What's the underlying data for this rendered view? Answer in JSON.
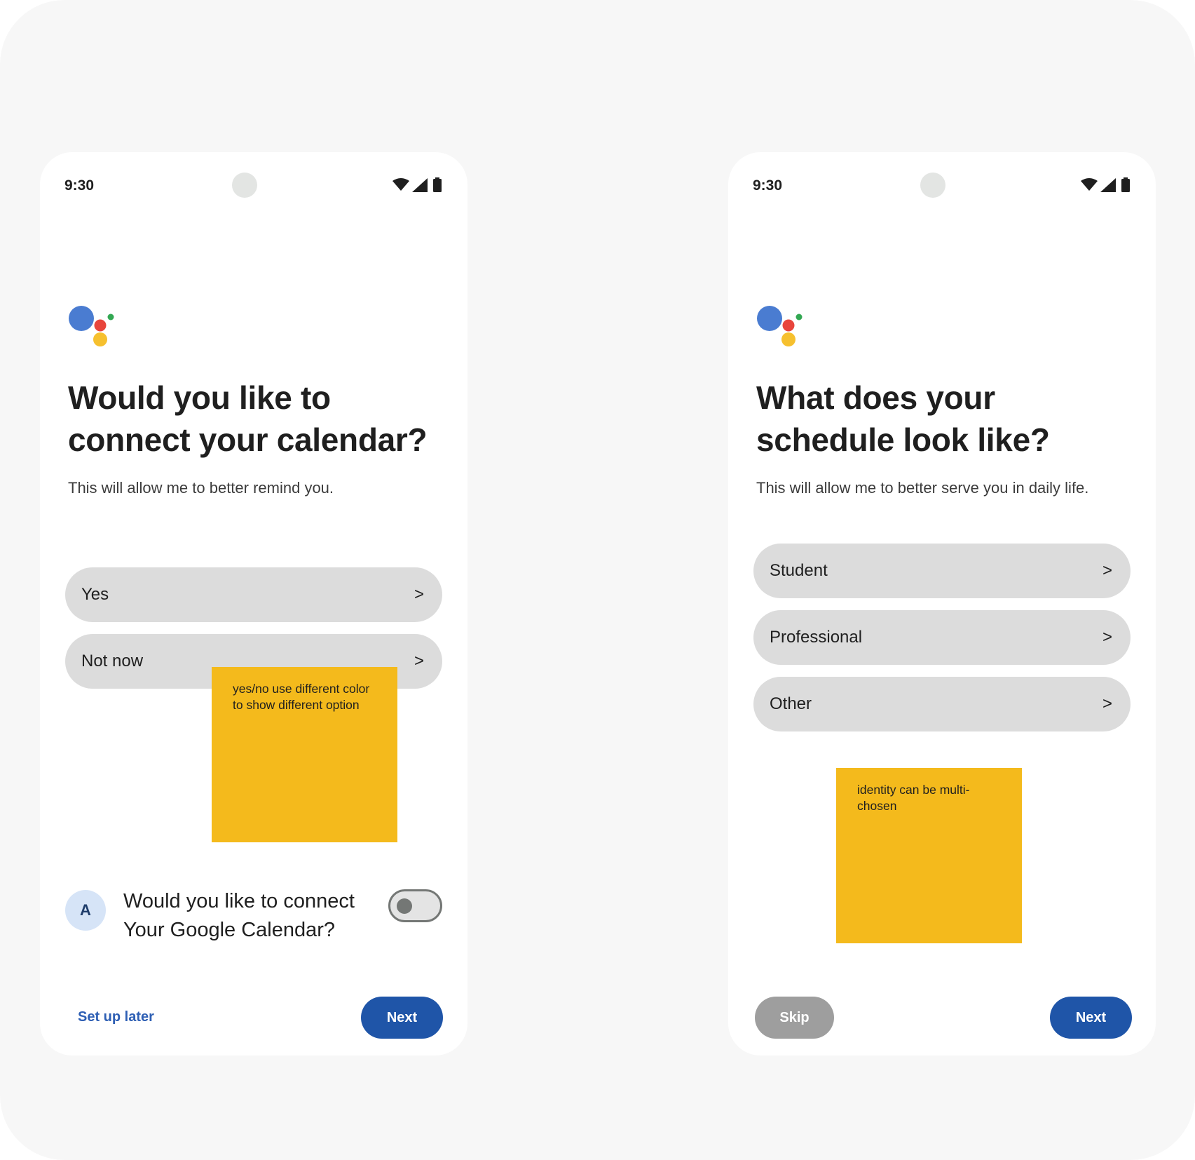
{
  "left_screen": {
    "status": {
      "time": "9:30"
    },
    "title": "Would you like to connect your calendar?",
    "subtitle": "This will allow me to better remind you.",
    "options": [
      {
        "label": "Yes",
        "chevron": ">"
      },
      {
        "label": "Not now",
        "chevron": ">"
      }
    ],
    "note": "yes/no use different color to show different option",
    "connect": {
      "avatar_letter": "A",
      "text_line1": "Would you like to connect",
      "text_line2": "Your Google Calendar?",
      "toggle_on": false
    },
    "footer": {
      "secondary_label": "Set up later",
      "primary_label": "Next"
    }
  },
  "right_screen": {
    "status": {
      "time": "9:30"
    },
    "title": "What does your schedule look like?",
    "subtitle": "This will allow me to better serve you in daily life.",
    "options": [
      {
        "label": "Student",
        "chevron": ">"
      },
      {
        "label": "Professional",
        "chevron": ">"
      },
      {
        "label": "Other",
        "chevron": ">"
      }
    ],
    "note": "identity can be multi-chosen",
    "footer": {
      "secondary_label": "Skip",
      "primary_label": "Next"
    }
  },
  "colors": {
    "primary_button": "#1f55a8",
    "sticky_note": "#f4ba1c",
    "option_background": "#dcdcdc",
    "logo_blue": "#4a7cd1",
    "logo_red": "#e8453c",
    "logo_yellow": "#f6c02e",
    "logo_green": "#33a853"
  },
  "icons": [
    "wifi-icon",
    "cellular-signal-icon",
    "battery-icon",
    "assistant-logo-icon"
  ]
}
